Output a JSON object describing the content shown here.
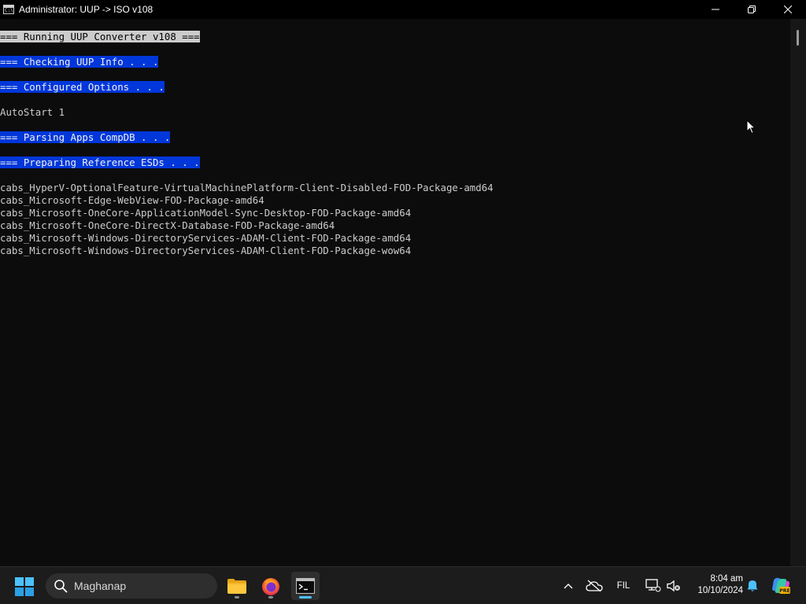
{
  "window": {
    "title": "Administrator:  UUP -> ISO v108",
    "icon_text": "C:\\",
    "controls": [
      "minimize-icon",
      "restore-icon",
      "close-icon"
    ]
  },
  "console": {
    "lines": [
      {
        "text": "=== Running UUP Converter v108 ===",
        "style": "gray"
      },
      {
        "text": "",
        "style": "none"
      },
      {
        "text": "=== Checking UUP Info . . .",
        "style": "blue"
      },
      {
        "text": "",
        "style": "none"
      },
      {
        "text": "=== Configured Options . . .",
        "style": "blue"
      },
      {
        "text": "",
        "style": "none"
      },
      {
        "text": "AutoStart 1",
        "style": "none"
      },
      {
        "text": "",
        "style": "none"
      },
      {
        "text": "=== Parsing Apps CompDB . . .",
        "style": "blue"
      },
      {
        "text": "",
        "style": "none"
      },
      {
        "text": "=== Preparing Reference ESDs . . .",
        "style": "blue"
      },
      {
        "text": "",
        "style": "none"
      },
      {
        "text": "cabs_HyperV-OptionalFeature-VirtualMachinePlatform-Client-Disabled-FOD-Package-amd64",
        "style": "none"
      },
      {
        "text": "cabs_Microsoft-Edge-WebView-FOD-Package-amd64",
        "style": "none"
      },
      {
        "text": "cabs_Microsoft-OneCore-ApplicationModel-Sync-Desktop-FOD-Package-amd64",
        "style": "none"
      },
      {
        "text": "cabs_Microsoft-OneCore-DirectX-Database-FOD-Package-amd64",
        "style": "none"
      },
      {
        "text": "cabs_Microsoft-Windows-DirectoryServices-ADAM-Client-FOD-Package-amd64",
        "style": "none"
      },
      {
        "text": "cabs_Microsoft-Windows-DirectoryServices-ADAM-Client-FOD-Package-wow64",
        "style": "none"
      }
    ]
  },
  "taskbar": {
    "search_text": "Maghanap",
    "apps": [
      {
        "name": "file-explorer-icon",
        "active": false
      },
      {
        "name": "firefox-icon",
        "active": false
      },
      {
        "name": "command-prompt-icon",
        "active": true
      }
    ],
    "tray": {
      "language": "FIL",
      "time": "8:04 am",
      "date": "10/10/2024",
      "copilot_badge": "PRE"
    }
  },
  "colors": {
    "console_bg": "#0c0c0c",
    "highlight_blue": "#0037da",
    "highlight_gray": "#cccccc",
    "taskbar_bg": "#1c1c1c",
    "accent": "#4cc2ff"
  }
}
